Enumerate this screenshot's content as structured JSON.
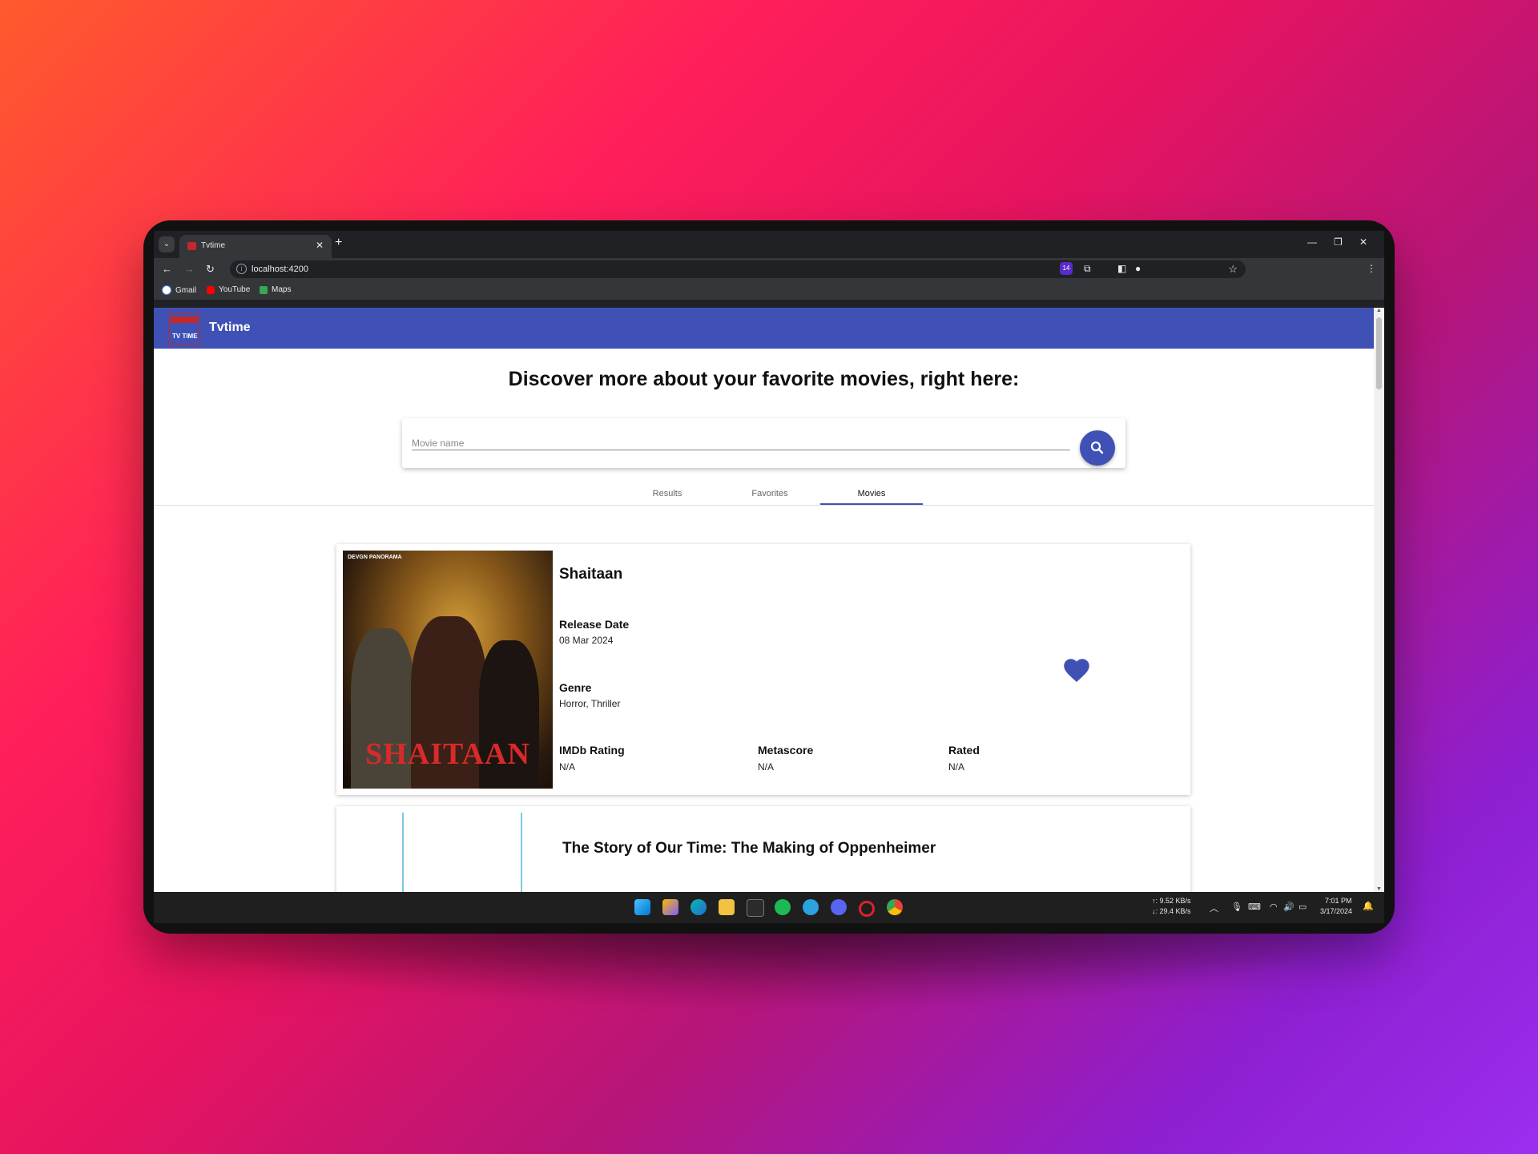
{
  "browser": {
    "tab_title": "Tvtime",
    "tab_close": "✕",
    "new_tab": "+",
    "url": "localhost:4200",
    "bookmarks": [
      "Gmail",
      "YouTube",
      "Maps"
    ],
    "extension_badge": "14"
  },
  "app": {
    "title": "Tvtime",
    "logo_text": "TV TIME",
    "headline": "Discover more about your favorite movies, right here:",
    "search_placeholder": "Movie name",
    "tabs": [
      "Results",
      "Favorites",
      "Movies"
    ],
    "active_tab": "Movies"
  },
  "movies": [
    {
      "title": "Shaitaan",
      "poster_title": "SHAITAAN",
      "poster_topline": "DEVGN PANORAMA",
      "release_date_label": "Release Date",
      "release_date": "08 Mar 2024",
      "genre_label": "Genre",
      "genre": "Horror, Thriller",
      "imdb_label": "IMDb Rating",
      "imdb": "N/A",
      "metascore_label": "Metascore",
      "metascore": "N/A",
      "rated_label": "Rated",
      "rated": "N/A",
      "favorite": true
    },
    {
      "title": "The Story of Our Time: The Making of Oppenheimer"
    }
  ],
  "taskbar": {
    "net_up": "↑: 9.52 KB/s",
    "net_down": "↓: 29.4 KB/s",
    "time": "7:01 PM",
    "date": "3/17/2024"
  },
  "colors": {
    "primary": "#3f51b5",
    "heart": "#3f51b5"
  }
}
